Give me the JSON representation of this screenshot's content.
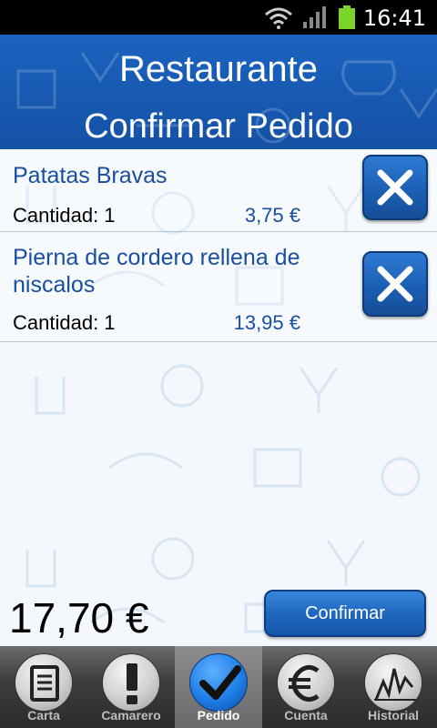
{
  "status_bar": {
    "time": "16:41"
  },
  "header": {
    "title": "Restaurante",
    "subtitle": "Confirmar Pedido"
  },
  "order_items": [
    {
      "name": "Patatas Bravas",
      "quantity_label": "Cantidad: 1",
      "price": "3,75 €"
    },
    {
      "name": "Pierna de cordero rellena de niscalos",
      "quantity_label": "Cantidad: 1",
      "price": "13,95 €"
    }
  ],
  "total": "17,70 €",
  "confirm_button": "Confirmar",
  "tabs": [
    {
      "label": "Carta",
      "icon": "menu-list-icon",
      "active": false
    },
    {
      "label": "Camarero",
      "icon": "exclamation-icon",
      "active": false
    },
    {
      "label": "Pedido",
      "icon": "checkmark-icon",
      "active": true
    },
    {
      "label": "Cuenta",
      "icon": "euro-icon",
      "active": false
    },
    {
      "label": "Historial",
      "icon": "chart-icon",
      "active": false
    }
  ],
  "colors": {
    "header_blue": "#1659b0",
    "item_text_blue": "#1a4ea0",
    "tab_active_blue": "#1e7ee6"
  }
}
